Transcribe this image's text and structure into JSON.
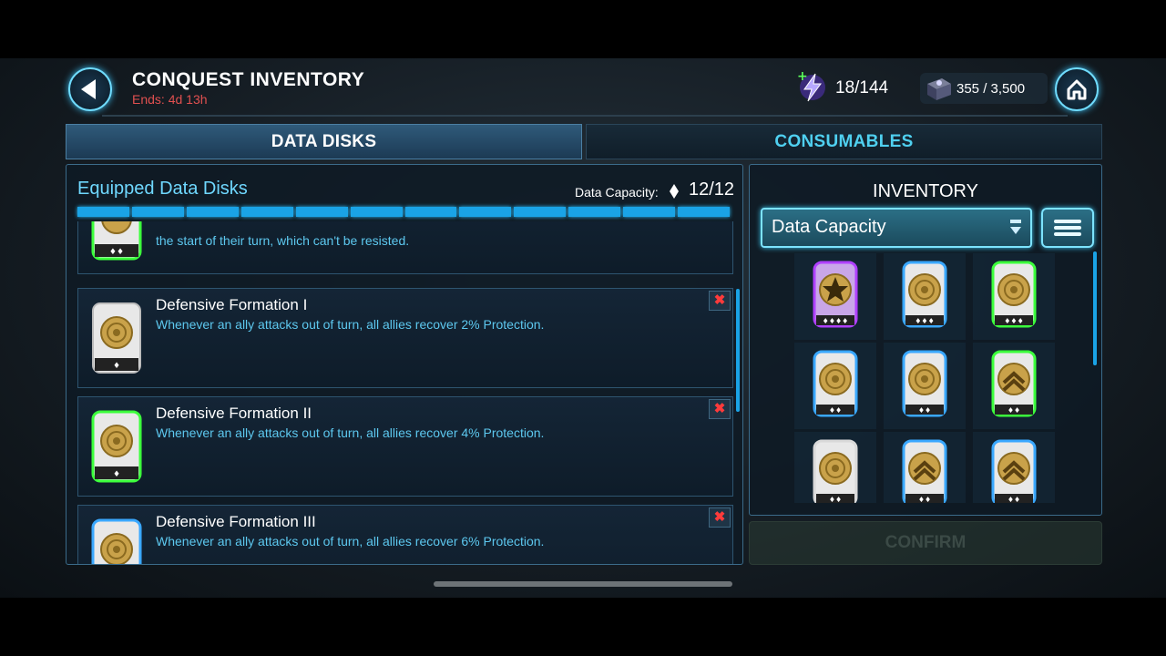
{
  "header": {
    "title": "CONQUEST INVENTORY",
    "ends": "Ends: 4d 13h",
    "energy": "18/144",
    "tokens": "355 / 3,500"
  },
  "tabs": [
    {
      "label": "DATA DISKS",
      "active": true
    },
    {
      "label": "CONSUMABLES",
      "active": false
    }
  ],
  "equipped": {
    "title": "Equipped Data Disks",
    "capacity_label": "Data Capacity:",
    "capacity_value": "12/12",
    "capacity_used": 12,
    "capacity_total": 12,
    "partial_text": "the start of their turn, which can't be resisted.",
    "disks": [
      {
        "name": "Defensive Formation I",
        "desc": "Whenever an ally attacks out of turn, all allies recover 2% Protection.",
        "rarity": "white",
        "pips": 1
      },
      {
        "name": "Defensive Formation II",
        "desc": "Whenever an ally attacks out of turn, all allies recover 4% Protection.",
        "rarity": "green",
        "pips": 1
      },
      {
        "name": "Defensive Formation III",
        "desc": "Whenever an ally attacks out of turn, all allies recover 6% Protection.",
        "rarity": "blue",
        "pips": 1
      }
    ]
  },
  "inventory": {
    "title": "INVENTORY",
    "sort_label": "Data Capacity",
    "items": [
      {
        "rarity": "purple",
        "symbol": "burst",
        "pips": 4
      },
      {
        "rarity": "blue",
        "symbol": "rings",
        "pips": 3
      },
      {
        "rarity": "green",
        "symbol": "rings",
        "pips": 3
      },
      {
        "rarity": "blue",
        "symbol": "rings",
        "pips": 2
      },
      {
        "rarity": "blue",
        "symbol": "rings",
        "pips": 2
      },
      {
        "rarity": "green",
        "symbol": "chevron",
        "pips": 2
      },
      {
        "rarity": "white",
        "symbol": "rings",
        "pips": 2
      },
      {
        "rarity": "blue",
        "symbol": "chevron",
        "pips": 2
      },
      {
        "rarity": "blue",
        "symbol": "chevron",
        "pips": 2
      }
    ]
  },
  "confirm_label": "CONFIRM",
  "colors": {
    "accent": "#4fd0f0",
    "danger": "#ff3b3b",
    "white": "#d9d9d9",
    "green": "#3cff3c",
    "blue": "#3aa8ff",
    "purple": "#b040ff"
  }
}
